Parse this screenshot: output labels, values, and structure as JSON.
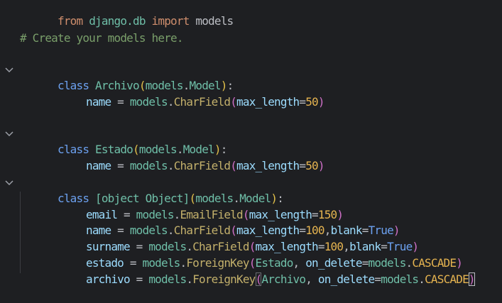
{
  "editor": {
    "line1": {
      "kw_from": "from",
      "module": "django.db",
      "kw_import": "import",
      "name": "models"
    },
    "line3": {
      "comment": "# Create your models here."
    },
    "class_archivo": {
      "kw": "class",
      "name": "Archivo",
      "base_mod": "models",
      "dot": ".",
      "base": "Model",
      "colon": ":",
      "field_name": "name",
      "eq": " = ",
      "mod": "models",
      "field_type": "CharField",
      "arg_name": "max_length",
      "arg_val": "50"
    },
    "class_estado": {
      "kw": "class",
      "name": "Estado",
      "base_mod": "models",
      "dot": ".",
      "base": "Model",
      "colon": ":",
      "field_name": "name",
      "eq": " = ",
      "mod": "models",
      "field_type": "CharField",
      "arg_name": "max_length",
      "arg_val": "50"
    },
    "class_usuario": {
      "kw": "class",
      "name": {
        "name": "name",
        "type": "CharField",
        "arg": "max_length",
        "val": "100",
        "arg2": "blank",
        "val2": "True"
      },
      "base_mod": "models",
      "dot": ".",
      "base": "Model",
      "colon": ":",
      "email": {
        "name": "email",
        "type": "EmailField",
        "arg": "max_length",
        "val": "150"
      },
      "surname": {
        "name": "surname",
        "type": "CharField",
        "arg": "max_length",
        "val": "100",
        "arg2": "blank",
        "val2": "True"
      },
      "estado": {
        "name": "estado",
        "type": "ForeignKey",
        "ref": "Estado",
        "arg": "on_delete",
        "val_mod": "models",
        "val": "CASCADE"
      },
      "archivo": {
        "name": "archivo",
        "type": "ForeignKey",
        "ref": "Archivo",
        "arg": "on_delete",
        "val_mod": "models",
        "val": "CASCADE"
      }
    },
    "colors": {
      "background": "#1e1f22",
      "keyword": "#6ca1f0",
      "class_name": "#6fbfa8",
      "comment": "#7a9f6a",
      "number": "#e6b450"
    },
    "icons": {
      "fold": "chevron-down-icon"
    }
  }
}
